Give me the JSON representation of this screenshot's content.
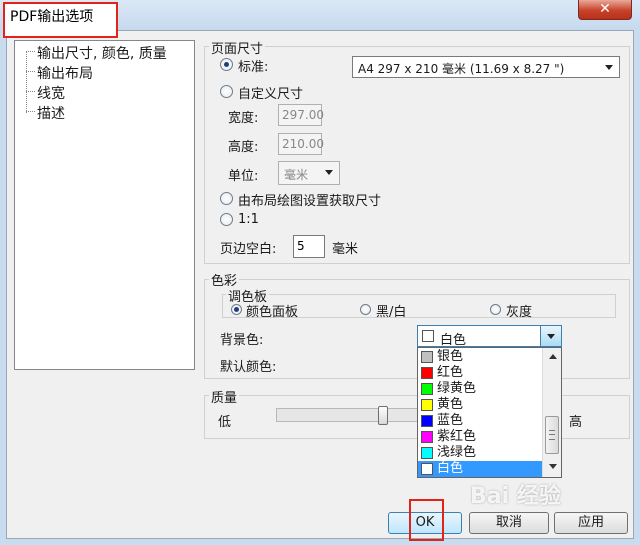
{
  "window": {
    "title": "PDF输出选项",
    "close_glyph": "✕"
  },
  "tree": {
    "items": [
      "输出尺寸, 颜色, 质量",
      "输出布局",
      "线宽",
      "描述"
    ]
  },
  "page_size": {
    "group_title": "页面尺寸",
    "standard_label": "标准:",
    "standard_value": "A4 297 x 210 毫米 (11.69 x 8.27 \")",
    "custom_label": "自定义尺寸",
    "width_label": "宽度:",
    "width_value": "297.00",
    "height_label": "高度:",
    "height_value": "210.00",
    "unit_label": "单位:",
    "unit_value": "毫米",
    "from_layout_label": "由布局绘图设置获取尺寸",
    "one_to_one_label": "1:1",
    "margin_label": "页边空白:",
    "margin_value": "5",
    "margin_unit": "毫米"
  },
  "color": {
    "group_title": "色彩",
    "palette_title": "调色板",
    "palette_color": "颜色面板",
    "palette_bw": "黑/白",
    "palette_gray": "灰度",
    "bg_label": "背景色:",
    "bg_value": "白色",
    "default_label": "默认颜色:",
    "dropdown_options": [
      {
        "label": "银色",
        "color": "#c0c0c0"
      },
      {
        "label": "红色",
        "color": "#ff0000"
      },
      {
        "label": "绿黄色",
        "color": "#00ff00"
      },
      {
        "label": "黄色",
        "color": "#ffff00"
      },
      {
        "label": "蓝色",
        "color": "#0000ff"
      },
      {
        "label": "紫红色",
        "color": "#ff00ff"
      },
      {
        "label": "浅绿色",
        "color": "#00ffff"
      },
      {
        "label": "白色",
        "color": "#ffffff"
      }
    ],
    "selected_index": 7
  },
  "quality": {
    "group_title": "质量",
    "low_label": "低",
    "high_label": "高",
    "level": 0.37
  },
  "buttons": {
    "ok": "OK",
    "cancel": "取消",
    "apply": "应用"
  },
  "watermark": "Bai 经验"
}
